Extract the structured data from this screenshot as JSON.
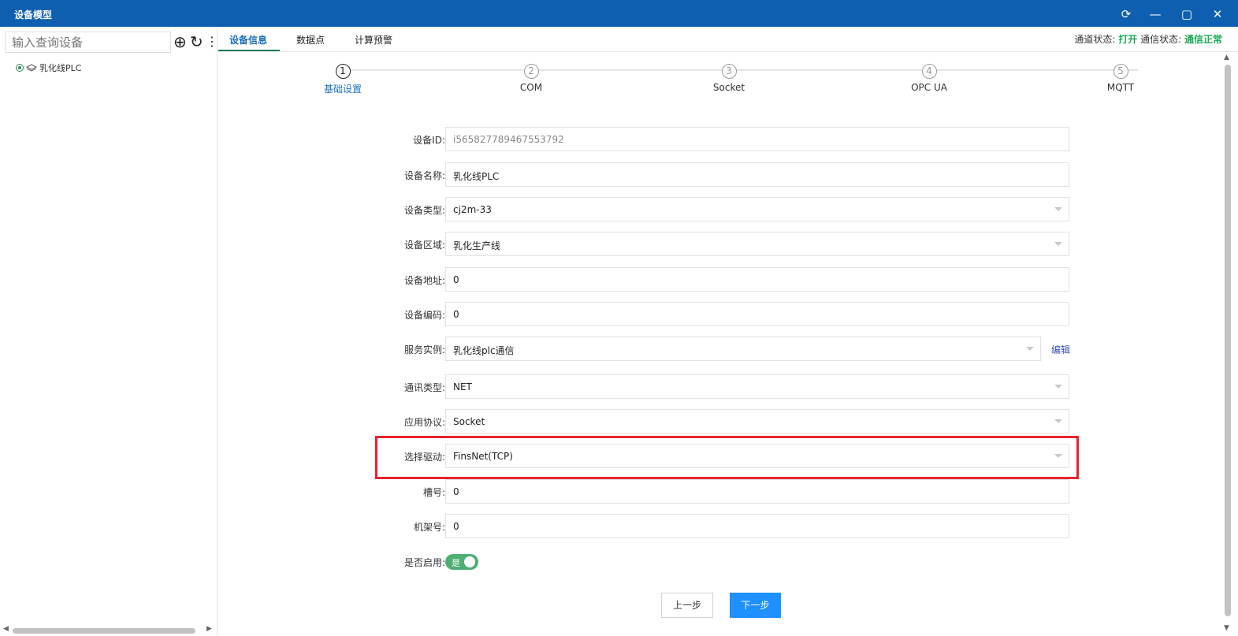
{
  "window": {
    "title": "设备模型",
    "buttons": {
      "refresh": "⟳",
      "minimize": "—",
      "maximize": "▢",
      "close": "✕"
    }
  },
  "sidebar": {
    "search_placeholder": "输入查询设备",
    "add_icon": "⊕",
    "refresh_icon": "↻",
    "more_icon": "⋮",
    "tree": [
      {
        "label": "乳化线PLC",
        "icon": "layers-icon"
      }
    ]
  },
  "tabs": [
    {
      "label": "设备信息",
      "active": true
    },
    {
      "label": "数据点",
      "active": false
    },
    {
      "label": "计算预警",
      "active": false
    }
  ],
  "status": {
    "channel_label": "通道状态:",
    "channel_value": "打开",
    "comm_label": "通信状态:",
    "comm_value": "通信正常"
  },
  "steps": [
    {
      "num": "1",
      "label": "基础设置",
      "active": true
    },
    {
      "num": "2",
      "label": "COM",
      "active": false
    },
    {
      "num": "3",
      "label": "Socket",
      "active": false
    },
    {
      "num": "4",
      "label": "OPC UA",
      "active": false
    },
    {
      "num": "5",
      "label": "MQTT",
      "active": false
    }
  ],
  "form": {
    "device_id": {
      "label": "设备ID:",
      "value": "i565827789467553792"
    },
    "device_name": {
      "label": "设备名称:",
      "value": "乳化线PLC"
    },
    "device_type": {
      "label": "设备类型:",
      "value": "cj2m-33"
    },
    "device_area": {
      "label": "设备区域:",
      "value": "乳化生产线"
    },
    "device_address": {
      "label": "设备地址:",
      "value": "0"
    },
    "device_code": {
      "label": "设备编码:",
      "value": "0"
    },
    "service_instance": {
      "label": "服务实例:",
      "value": "乳化线plc通信",
      "edit": "编辑"
    },
    "comm_type": {
      "label": "通讯类型:",
      "value": "NET"
    },
    "protocol": {
      "label": "应用协议:",
      "value": "Socket"
    },
    "driver": {
      "label": "选择驱动:",
      "value": "FinsNet(TCP)"
    },
    "slot": {
      "label": "槽号:",
      "value": "0"
    },
    "rack": {
      "label": "机架号:",
      "value": "0"
    },
    "enabled": {
      "label": "是否启用:",
      "value": "是",
      "on": true
    }
  },
  "buttons": {
    "prev": "上一步",
    "next": "下一步"
  },
  "colors": {
    "titlebar": "#0f5fb0",
    "accent": "#1e90ff",
    "status_green": "#1aaa55",
    "highlight": "#e8232b",
    "toggle": "#4fae73"
  }
}
